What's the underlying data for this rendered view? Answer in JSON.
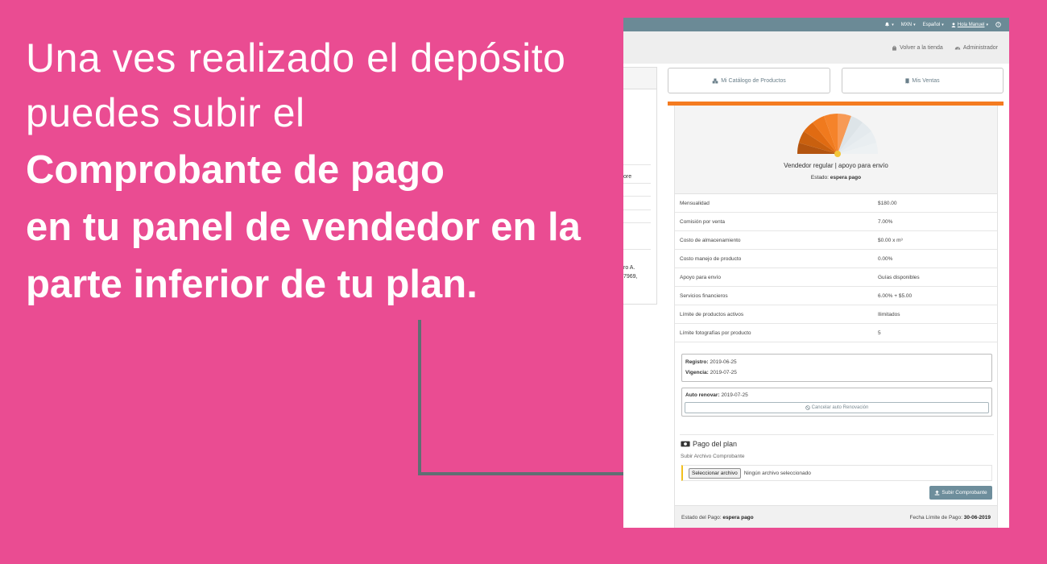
{
  "headline": {
    "line1": "Una ves realizado el depósito",
    "line2": "puedes subir el",
    "line3": "Comprobante de pago",
    "line4": "en tu panel de vendedor en la",
    "line5": "parte inferior de tu plan."
  },
  "colors": {
    "background": "#ea4c92",
    "topbar": "#6b8a96",
    "accent_orange": "#f47b20",
    "connector": "#5f6f73",
    "upload_button": "#6e8e9c"
  },
  "topbar": {
    "bell_icon": "bell-icon",
    "currency": "MXN",
    "language": "Español",
    "user": "Hola Manuel",
    "help_icon": "help-circle-icon"
  },
  "subbar": {
    "store_link": "Volver a la tienda",
    "admin_link": "Administrador"
  },
  "left_fragments": {
    "row1": "ore",
    "addr1": "ro A.",
    "addr2": "7969,"
  },
  "nav": {
    "catalog": "Mi Catálogo de Productos",
    "sales": "Mis Ventas"
  },
  "plan": {
    "title": "Vendedor regular | apoyo para envío",
    "status_label": "Estado:",
    "status_value": "espera pago"
  },
  "features": [
    {
      "label": "Mensualidad",
      "value": "$180.00"
    },
    {
      "label": "Comisión por venta",
      "value": "7.00%"
    },
    {
      "label": "Costo de almacenamiento",
      "value": "$0.00 x m³"
    },
    {
      "label": "Costo manejo de producto",
      "value": "0.00%"
    },
    {
      "label": "Apoyo para envío",
      "value": "Guías disponibles"
    },
    {
      "label": "Servicios financieros",
      "value": "6.00% + $5.00"
    },
    {
      "label": "Límite de productos activos",
      "value": "Ilimitados"
    },
    {
      "label": "Límite fotografías por producto",
      "value": "5"
    }
  ],
  "dates": {
    "registro_label": "Registro:",
    "registro_value": "2019-06-25",
    "vigencia_label": "Vigencia:",
    "vigencia_value": "2019-07-25"
  },
  "renewal": {
    "label": "Auto renovar:",
    "value": "2019-07-25",
    "cancel_button": "Cancelar auto Renovación"
  },
  "payment": {
    "title": "Pago del plan",
    "subtitle": "Subir Archivo Comprobante",
    "file_button": "Seleccionar archivo",
    "file_status": "Ningún archivo seleccionado",
    "upload_button": "Subir Comprobante"
  },
  "footer": {
    "status_label": "Estado del Pago:",
    "status_value": "espera pago",
    "deadline_label": "Fecha Límite de Pago:",
    "deadline_value": "30-06-2019"
  }
}
